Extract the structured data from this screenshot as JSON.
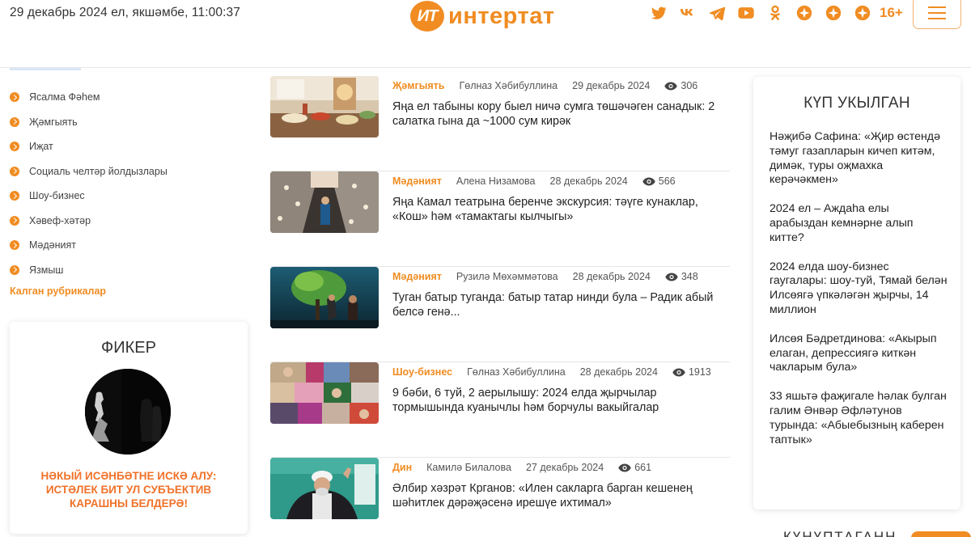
{
  "header": {
    "date": "29 декабрь 2024 ел, якшәмбе, 11:00:37",
    "logo_badge": "ИТ",
    "logo_text": "интертат",
    "age_rating": "16+",
    "socials": [
      "twitter-icon",
      "vk-icon",
      "telegram-icon",
      "youtube-icon",
      "odnoklassniki-icon",
      "social-icon",
      "social-icon",
      "social-icon"
    ],
    "accent_color": "#f08c22"
  },
  "sidebar": {
    "rubrics": [
      {
        "label": "Ясалма Фәһем"
      },
      {
        "label": "Җәмгыять"
      },
      {
        "label": "Иҗат"
      },
      {
        "label": "Социаль челтәр йолдызлары"
      },
      {
        "label": "Шоу-бизнес"
      },
      {
        "label": "Хәвеф-хәтәр"
      },
      {
        "label": "Мәдәният"
      },
      {
        "label": "Язмыш"
      }
    ],
    "more_label": "Калган рубрикалар",
    "fiker": {
      "title": "ФИКЕР",
      "caption": "НӘКЫЙ ИСӘНБӘТНЕ ИСКӘ АЛУ: ИСТӘЛЕК БИТ УЛ СУБЪЕКТИВ КАРАШНЫ БЕЛДЕРӘ!"
    }
  },
  "feed": {
    "items": [
      {
        "category": "Җәмгыять",
        "author": "Гөлназ Хәбибуллина",
        "date": "29 декабрь 2024",
        "views": "306",
        "title": "Яңа ел табыны кору быел ничә сумга төшәчәген санадык: 2 салатка гына да ~1000 сум кирәк"
      },
      {
        "category": "Мәдәният",
        "author": "Алена Низамова",
        "date": "28 декабрь 2024",
        "views": "566",
        "title": "Яңа Камал театрына беренче экскурсия: тәүге кунаклар, «Кош» һәм «тамактагы кылчыгы»"
      },
      {
        "category": "Мәдәният",
        "author": "Рузилә Мөхәммәтова",
        "date": "28 декабрь 2024",
        "views": "348",
        "title": "Туган батыр туганда: батыр татар нинди була – Радик абый белсә генә..."
      },
      {
        "category": "Шоу-бизнес",
        "author": "Гөлназ Хәбибуллина",
        "date": "28 декабрь 2024",
        "views": "1913",
        "title": "9 бәби, 6 туй, 2 аерылышу: 2024 елда җырчылар тормышында куанычлы һәм борчулы вакыйгалар"
      },
      {
        "category": "Дин",
        "author": "Камилә Билалова",
        "date": "27 декабрь 2024",
        "views": "661",
        "title": "Әлбир хәзрәт Крганов: «Илен сакларга барган кешенең шәһитлек дәрәҗәсенә ирешүе ихтимал»"
      }
    ]
  },
  "popular": {
    "title": "КҮП УКЫЛГАН",
    "items": [
      {
        "title": "Нәҗибә Сафина: «Җир өстендә тәмуг газапларын кичеп китәм, димәк, туры оҗмахка керәчәкмен»"
      },
      {
        "title": "2024 ел – Аждаһа елы арабыздан кемнәрне алып китте?"
      },
      {
        "title": "2024 елда шоу-бизнес гаугалары: шоу-туй, Тямай белән Илсөягә үпкәләгән җырчы, 14 миллион"
      },
      {
        "title": "Илсөя Бәдретдинова: «Акырып елаган, депрессиягә киткән чакларым була»"
      },
      {
        "title": "33 яшьтә фаҗигале һәлак булган галим Әнвәр Әфләтунов турында: «Абыебызның каберен таптык»"
      }
    ]
  },
  "bottom": {
    "label": "КҮНҮПТАГАНН"
  }
}
